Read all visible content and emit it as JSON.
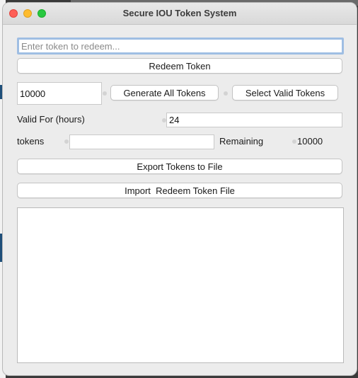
{
  "window": {
    "title": "Secure IOU Token System"
  },
  "redeem": {
    "placeholder": "Enter token to redeem...",
    "value": "",
    "button_label": "Redeem Token"
  },
  "generate": {
    "count_value": "10000",
    "generate_label": "Generate All Tokens",
    "select_label": "Select Valid Tokens"
  },
  "validity": {
    "label": "Valid For (hours)",
    "value": "24"
  },
  "tokens_row": {
    "label": "tokens",
    "value": "",
    "remaining_label": "Remaining",
    "remaining_value": "10000"
  },
  "actions": {
    "export_label": "Export Tokens to File",
    "import_label": "Import  Redeem Token File"
  },
  "output": {
    "text": ""
  }
}
